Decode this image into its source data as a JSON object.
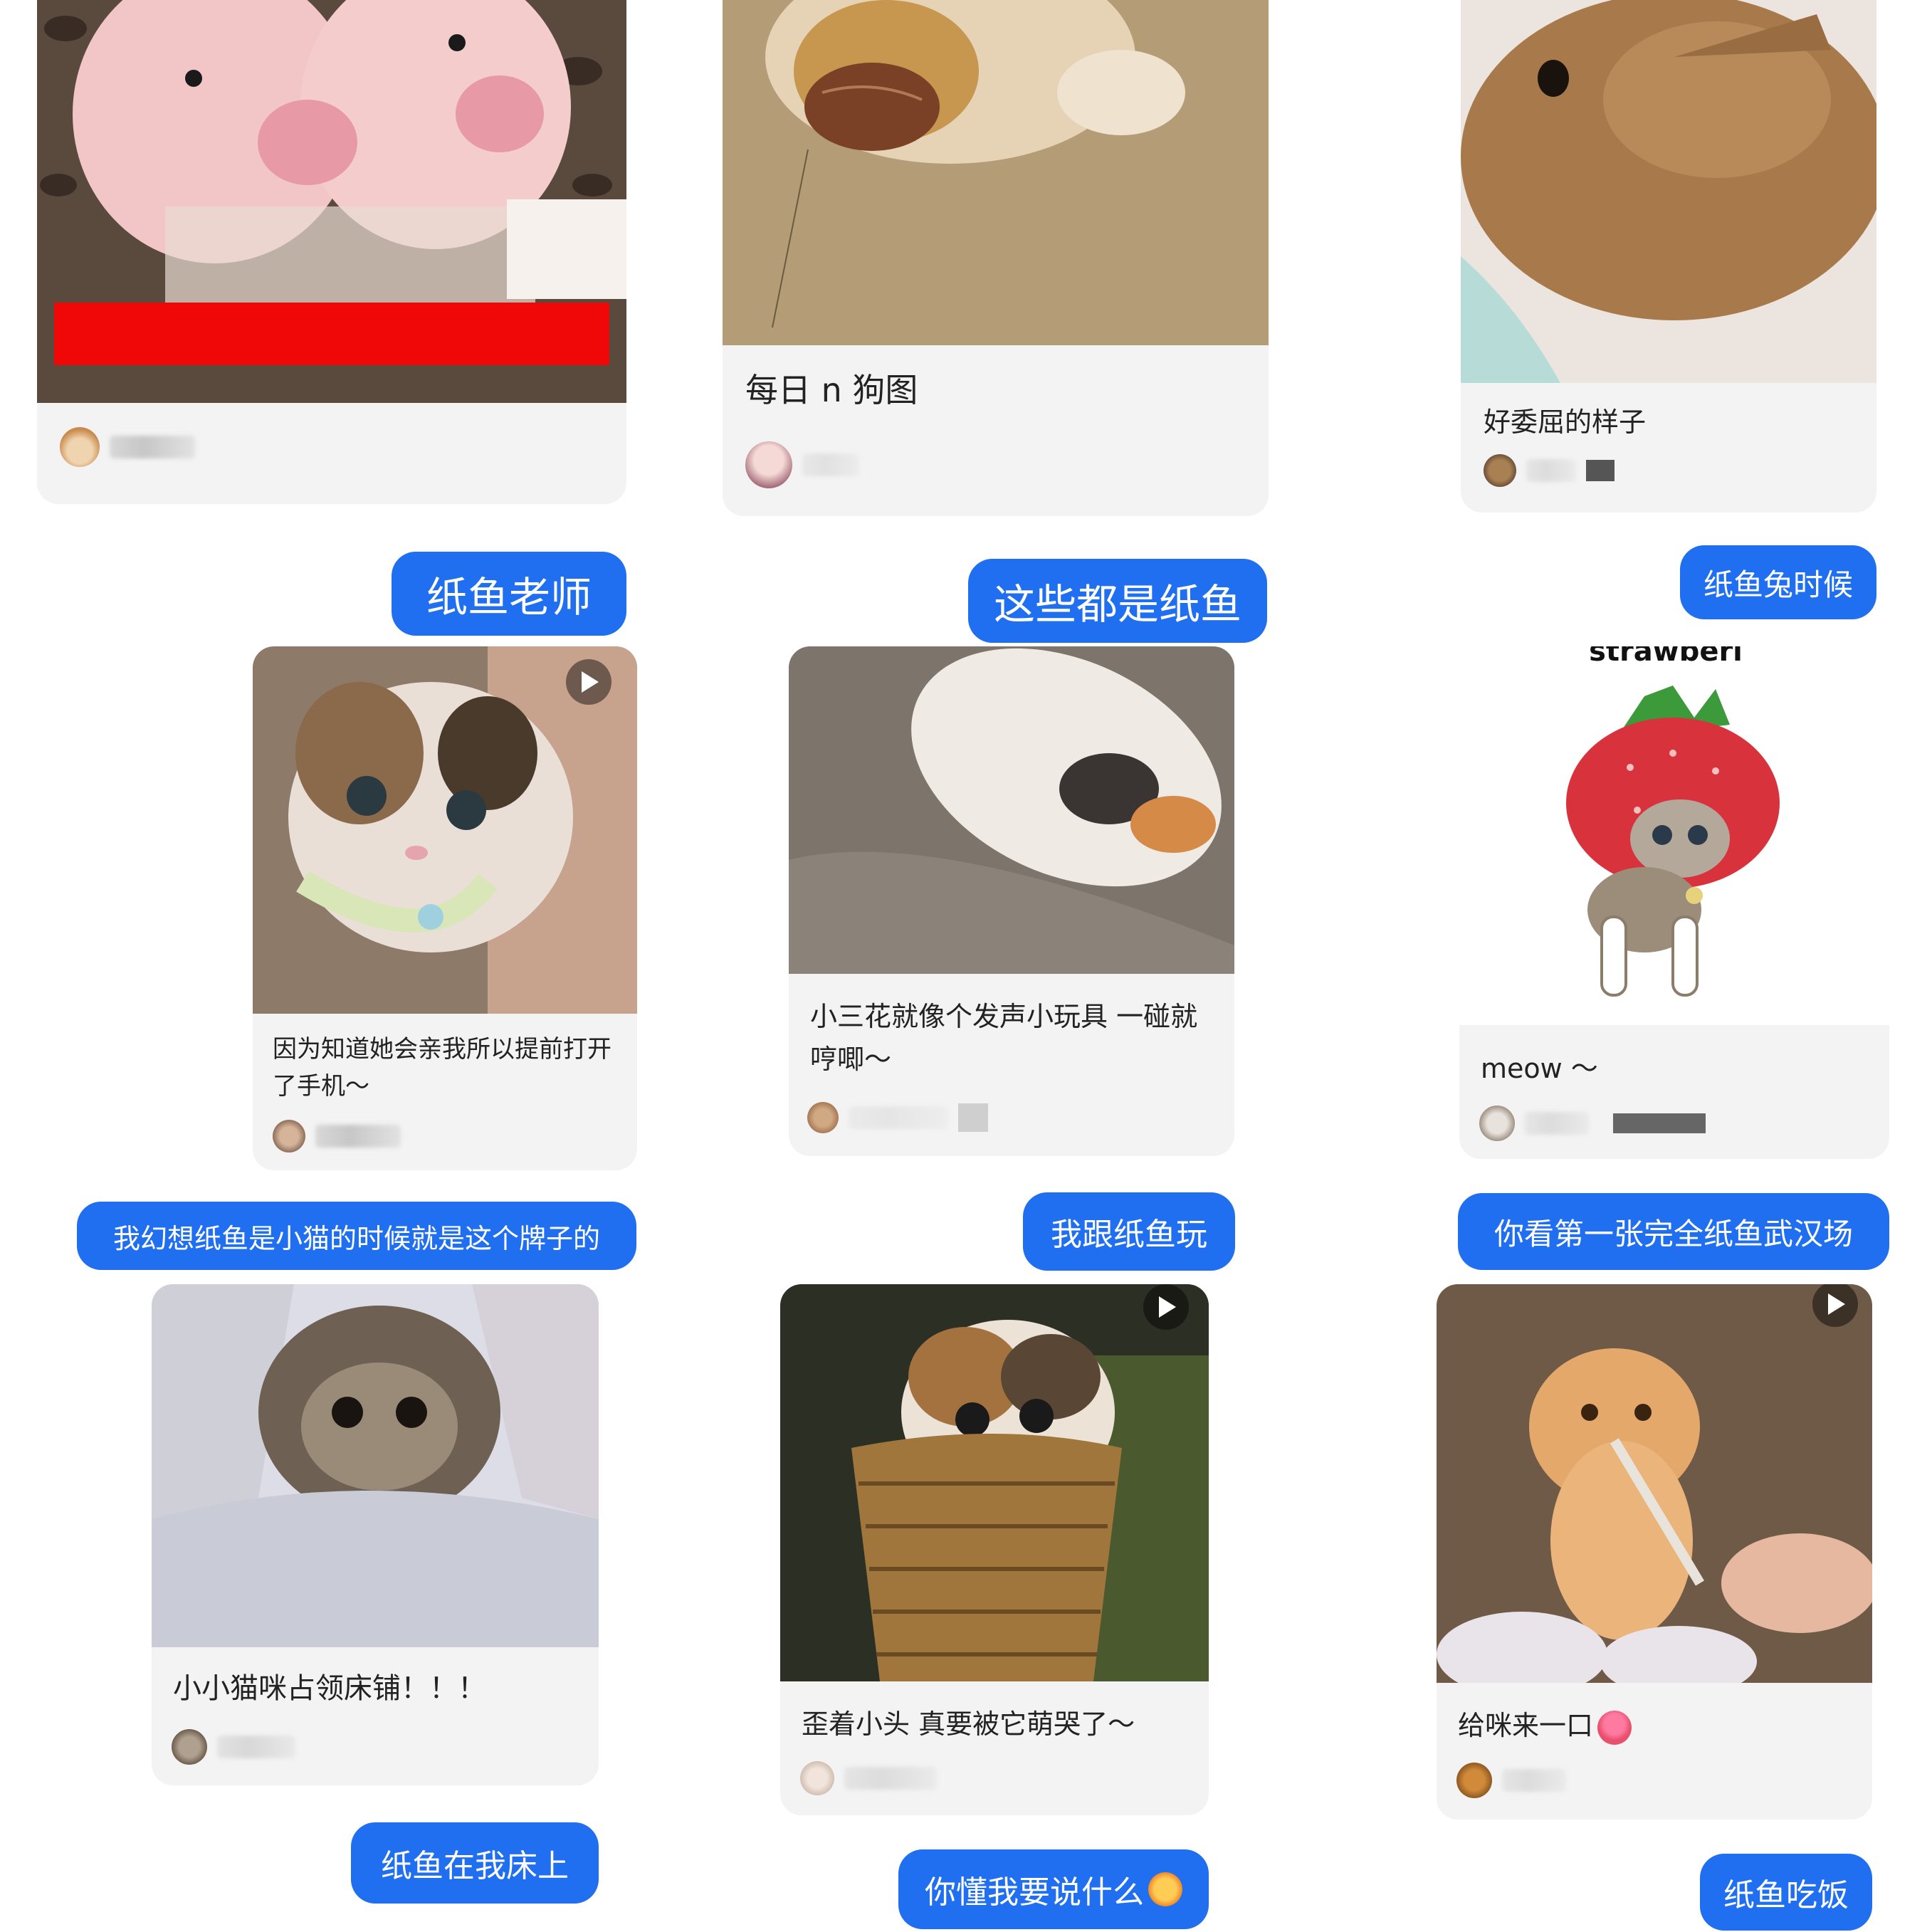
{
  "bubbles": {
    "b1": "纸鱼老师",
    "b2": "这些都是纸鱼",
    "b3": "纸鱼兔时候",
    "b4": "我幻想纸鱼是小猫的时候就是这个牌子的",
    "b5": "我跟纸鱼玩",
    "b6": "你看第一张完全纸鱼武汉场",
    "b7": "纸鱼在我床上",
    "b8": "你懂我要说什么",
    "b9": "纸鱼吃饭"
  },
  "posts": {
    "dog": {
      "caption": "每日 n 狗图"
    },
    "rabbit": {
      "caption": "好委屈的样子"
    },
    "kitten_kiss": {
      "caption": "因为知道她会亲我所以提前打开了手机～"
    },
    "kitten_toy": {
      "caption": "小三花就像个发声小玩具 一碰就哼唧～"
    },
    "strawberry": {
      "caption": "meow ～",
      "sticker_text": "strawberi"
    },
    "kitten_bed": {
      "caption": "小小猫咪占领床铺！！！"
    },
    "kitten_basket": {
      "caption": "歪着小头 真要被它萌哭了～"
    },
    "orange_cat": {
      "caption": "给咪来一口"
    }
  },
  "icons": {
    "play": "play-icon",
    "tongue_emoji": "tongue-emoji-icon",
    "cat_emoji": "angry-cat-emoji-icon"
  },
  "colors": {
    "bubble": "#1f6ff0",
    "card": "#f3f3f3",
    "redbar": "#f00808"
  }
}
